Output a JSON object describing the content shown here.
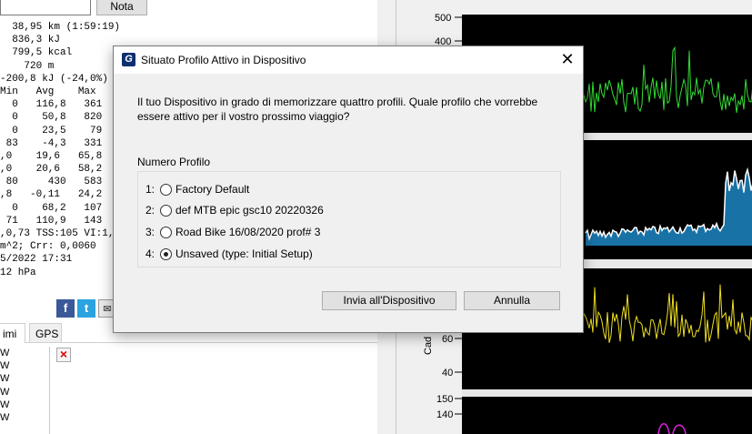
{
  "background": {
    "nota_label": "Nota",
    "stats_lines": [
      "  38,95 km (1:59:19)",
      "  836,3 kJ",
      "  799,5 kcal",
      "    720 m",
      "-200,8 kJ (-24,0%)",
      "Min   Avg    Max",
      "  0   116,8   361  W",
      "  0    50,8   820  W",
      "  0    23,5    79  W",
      " 83    -4,3   331  W",
      ",0    19,6   65,8  k",
      ",0    20,6   58,2  k",
      " 80     430   583  m",
      ",8   -0,11   24,2  %",
      "  0    68,2   107  r",
      " 71   110,9   143  b",
      ",0,73 TSS:105 VI:1,",
      "m^2; Crr: 0,0060",
      "5/2022 17:31",
      "12 hPa"
    ],
    "social": {
      "facebook": "f",
      "twitter": "t",
      "mail": "✉"
    },
    "tabs": [
      "imi",
      "GPS"
    ],
    "list_items": [
      "W",
      "W",
      "W",
      "W",
      "W",
      "W"
    ],
    "delete_glyph": "×",
    "charts": {
      "panel1_ticks": [
        "500",
        "400"
      ],
      "panel3_axis_label": "Cad",
      "panel3_ticks": [
        "60",
        "40"
      ],
      "panel4_ticks": [
        "150",
        "140"
      ],
      "colors": {
        "power": "#33dd33",
        "speed": "#ffffff",
        "speed_fill": "#1f8fd0",
        "cadence": "#f0e020",
        "heart": "#e020e0"
      }
    }
  },
  "dialog": {
    "title": "Situato Profilo Attivo in Dispositivo",
    "close_glyph": "✕",
    "message": "Il tuo Dispositivo in grado di memorizzare quattro profili. Quale profilo che vorrebbe essere attivo per il vostro prossimo viaggio?",
    "group_label": "Numero Profilo",
    "options": [
      {
        "num": "1:",
        "label": "Factory Default",
        "selected": false
      },
      {
        "num": "2:",
        "label": "def MTB epic gsc10 20220326",
        "selected": false
      },
      {
        "num": "3:",
        "label": "Road Bike 16/08/2020 prof# 3",
        "selected": false
      },
      {
        "num": "4:",
        "label": "Unsaved (type:  Initial Setup)",
        "selected": true
      }
    ],
    "send_label": "Invia all'Dispositivo",
    "cancel_label": "Annulla"
  }
}
